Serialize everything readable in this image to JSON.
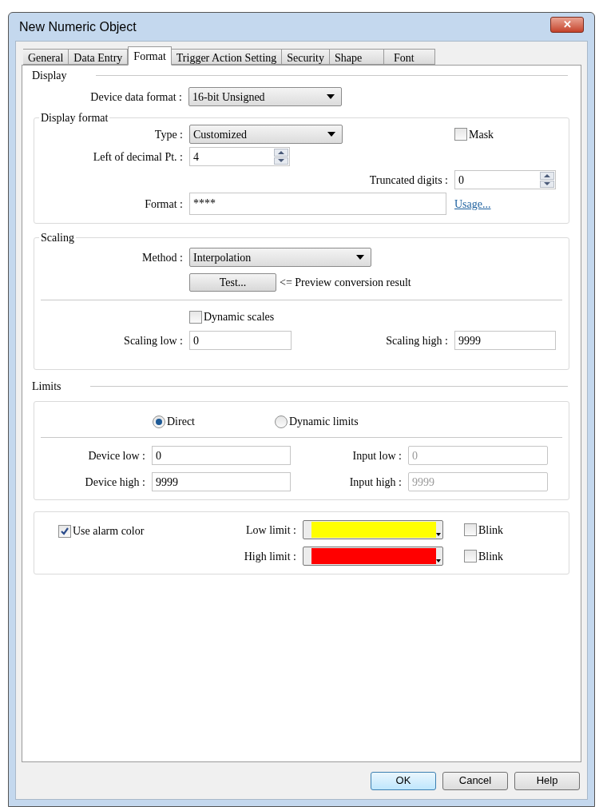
{
  "window": {
    "title": "New Numeric Object",
    "close": "✕"
  },
  "tabs": [
    {
      "label": "General",
      "selected": false
    },
    {
      "label": "Data Entry",
      "selected": false
    },
    {
      "label": "Format",
      "selected": true
    },
    {
      "label": "Trigger Action Setting",
      "selected": false
    },
    {
      "label": "Security",
      "selected": false
    },
    {
      "label": "Shape",
      "selected": false
    },
    {
      "label": "Font",
      "selected": false
    }
  ],
  "display": {
    "heading": "Display",
    "device_data_format": {
      "label": "Device data format :",
      "value": "16-bit Unsigned"
    }
  },
  "display_format": {
    "heading": "Display format",
    "type": {
      "label": "Type :",
      "value": "Customized"
    },
    "mask": {
      "label": "Mask",
      "checked": false
    },
    "left_of_decimal": {
      "label": "Left of decimal Pt. :",
      "value": "4"
    },
    "truncated_digits": {
      "label": "Truncated digits :",
      "value": "0"
    },
    "format": {
      "label": "Format :",
      "value": "****"
    },
    "usage_link": "Usage..."
  },
  "scaling": {
    "heading": "Scaling",
    "method": {
      "label": "Method :",
      "value": "Interpolation"
    },
    "test_button": "Test...",
    "test_note": "<= Preview conversion result",
    "dynamic_scales": {
      "label": "Dynamic scales",
      "checked": false
    },
    "scaling_low": {
      "label": "Scaling low :",
      "value": "0"
    },
    "scaling_high": {
      "label": "Scaling high :",
      "value": "9999"
    }
  },
  "limits": {
    "heading": "Limits",
    "modes": [
      {
        "label": "Direct",
        "selected": true
      },
      {
        "label": "Dynamic limits",
        "selected": false
      }
    ],
    "fields": [
      {
        "label": "Device low :",
        "value": "0",
        "disabled": false
      },
      {
        "label": "Input low :",
        "value": "0",
        "disabled": true
      },
      {
        "label": "Device high :",
        "value": "9999",
        "disabled": false
      },
      {
        "label": "Input high :",
        "value": "9999",
        "disabled": true
      }
    ]
  },
  "alarm": {
    "use_alarm_color": {
      "label": "Use alarm color",
      "checked": true
    },
    "rows": [
      {
        "label": "Low limit :",
        "color": "#ffff00",
        "blink": {
          "label": "Blink",
          "checked": false
        }
      },
      {
        "label": "High limit :",
        "color": "#ff0000",
        "blink": {
          "label": "Blink",
          "checked": false
        }
      }
    ]
  },
  "buttons": [
    {
      "label": "OK",
      "default": true
    },
    {
      "label": "Cancel",
      "default": false
    },
    {
      "label": "Help",
      "default": false
    }
  ]
}
